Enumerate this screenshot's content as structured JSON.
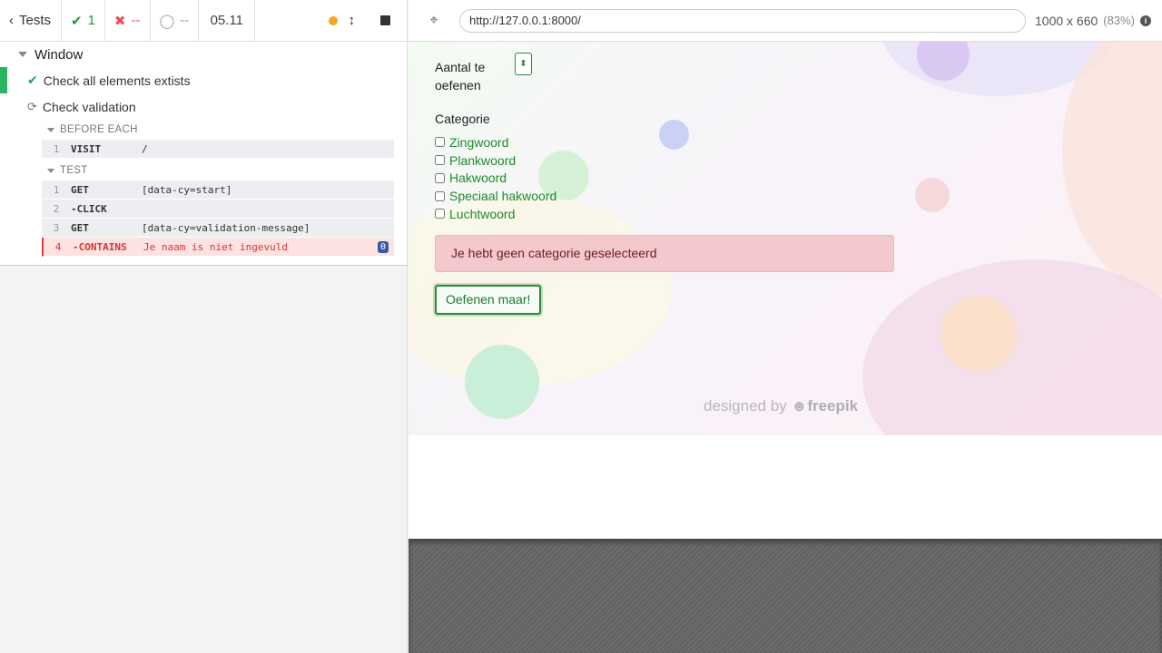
{
  "reporter": {
    "back_label": "Tests",
    "passed": "1",
    "failed": "--",
    "pending": "--",
    "duration": "05.11",
    "suite_title": "Window",
    "tests": [
      {
        "title": "Check all elements extists",
        "state": "passed"
      },
      {
        "title": "Check validation",
        "state": "running"
      }
    ],
    "before_each": {
      "title": "BEFORE EACH",
      "commands": [
        {
          "num": "1",
          "name": "VISIT",
          "message": "/"
        }
      ]
    },
    "test_hook": {
      "title": "TEST",
      "commands": [
        {
          "num": "1",
          "name": "GET",
          "message": "[data-cy=start]"
        },
        {
          "num": "2",
          "name": "-CLICK",
          "message": ""
        },
        {
          "num": "3",
          "name": "GET",
          "message": "[data-cy=validation-message]"
        },
        {
          "num": "4",
          "name": "-CONTAINS",
          "message": "Je naam is niet ingevuld",
          "badge": "0",
          "state": "failed"
        }
      ]
    }
  },
  "aut": {
    "url": "http://127.0.0.1:8000/",
    "viewport": "1000 x 660",
    "scale": "(83%)"
  },
  "app": {
    "amount_label": "Aantal te oefenen",
    "category_label": "Categorie",
    "categories": [
      "Zingwoord",
      "Plankwoord",
      "Hakwoord",
      "Speciaal hakwoord",
      "Luchtwoord"
    ],
    "alert_message": "Je hebt geen categorie geselecteerd",
    "submit_label": "Oefenen maar!",
    "credit_prefix": "designed by",
    "credit_brand": "freepik"
  },
  "colors": {
    "pass": "#1b9a3c",
    "fail": "#e94f5f",
    "accent_green": "#2a8a3a",
    "alert_bg": "#f4c9cd"
  }
}
